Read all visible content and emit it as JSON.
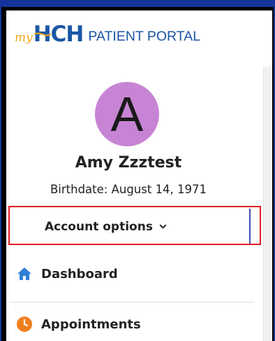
{
  "brand": {
    "my": "my",
    "hch": "HCH",
    "portal": "PATIENT PORTAL"
  },
  "user": {
    "avatar_initial": "A",
    "name": "Amy Zzztest",
    "birthdate": "Birthdate: August 14, 1971"
  },
  "account_options": {
    "label": "Account options",
    "icon": "chevron-down-icon"
  },
  "nav": [
    {
      "label": "Dashboard",
      "icon": "home-icon"
    },
    {
      "label": "Appointments",
      "icon": "clock-icon"
    }
  ],
  "colors": {
    "outer_frame": "#15339a",
    "brand_blue": "#1b56a5",
    "brand_gold": "#f2a615",
    "avatar_bg": "#c784d4",
    "highlight_red": "#e01b24",
    "home_icon": "#2f7fd6",
    "clock_icon": "#f07f1f"
  }
}
